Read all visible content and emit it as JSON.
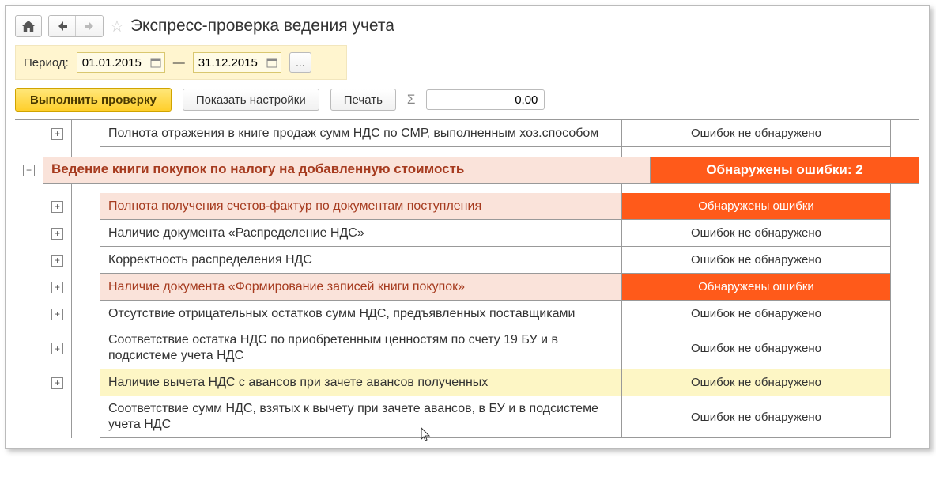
{
  "title": "Экспресс-проверка ведения учета",
  "period_label": "Период:",
  "date_from": "01.01.2015",
  "date_to": "31.12.2015",
  "date_sep": "—",
  "buttons": {
    "run": "Выполнить проверку",
    "settings": "Показать настройки",
    "print": "Печать",
    "dots": "..."
  },
  "sum_value": "0,00",
  "status": {
    "ok": "Ошибок не обнаружено",
    "found": "Обнаружены ошибки",
    "found_n": "Обнаружены ошибки: 2"
  },
  "rows": {
    "r0": "Полнота отражения в книге продаж сумм НДС по СМР, выполненным хоз.способом",
    "section": "Ведение книги покупок по налогу на добавленную стоимость",
    "r1": "Полнота получения счетов-фактур по документам поступления",
    "r2": "Наличие документа «Распределение НДС»",
    "r3": "Корректность распределения НДС",
    "r4": "Наличие документа «Формирование записей книги покупок»",
    "r5": "Отсутствие отрицательных остатков сумм НДС, предъявленных поставщиками",
    "r6": "Соответствие остатка НДС по приобретенным ценностям по счету 19 БУ и в подсистеме учета НДС",
    "r7": "Наличие вычета НДС с авансов при зачете авансов полученных",
    "r8": "Соответствие сумм НДС, взятых к вычету при зачете авансов, в БУ и в подсистеме учета НДС"
  }
}
